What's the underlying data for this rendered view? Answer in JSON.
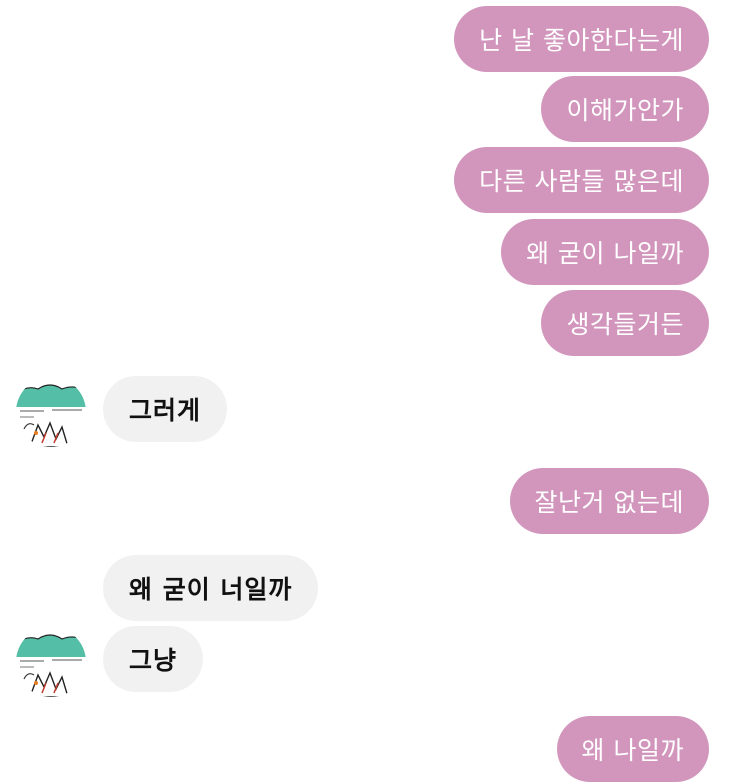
{
  "colors": {
    "outgoing_bubble": "#d296bd",
    "outgoing_text": "#ffffff",
    "incoming_bubble": "#f1f1f1",
    "incoming_text": "#111111",
    "avatar_accent": "#54bfa6"
  },
  "messages": [
    {
      "side": "out",
      "text": "난 날 좋아한다는게"
    },
    {
      "side": "out",
      "text": "이해가안가"
    },
    {
      "side": "out",
      "text": "다른 사람들 많은데"
    },
    {
      "side": "out",
      "text": "왜 굳이 나일까"
    },
    {
      "side": "out",
      "text": "생각들거든"
    },
    {
      "side": "in",
      "text": "그러게",
      "avatar": "profile-avatar"
    },
    {
      "side": "out",
      "text": "잘난거 없는데"
    },
    {
      "side": "in",
      "text": "왜 굳이 너일까"
    },
    {
      "side": "in",
      "text": "그냥",
      "avatar": "profile-avatar"
    },
    {
      "side": "out",
      "text": "왜 나일까"
    }
  ]
}
